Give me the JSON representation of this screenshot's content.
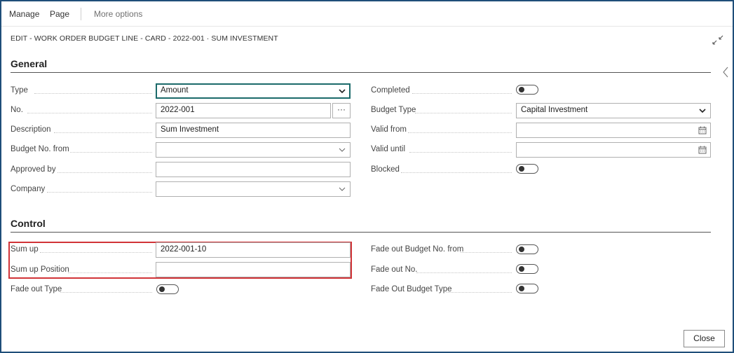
{
  "menu": {
    "manage": "Manage",
    "page": "Page",
    "more_options": "More options"
  },
  "title": "EDIT - WORK ORDER BUDGET LINE - CARD - 2022-001 · SUM INVESTMENT",
  "general": {
    "heading": "General",
    "left": [
      {
        "label": "Type",
        "value": "Amount",
        "control": "select-focused"
      },
      {
        "label": "No.",
        "value": "2022-001",
        "control": "text-with-lookup",
        "lookup_label": "···"
      },
      {
        "label": "Description",
        "value": "Sum Investment",
        "control": "text"
      },
      {
        "label": "Budget No. from",
        "value": "",
        "control": "select"
      },
      {
        "label": "Approved by",
        "value": "",
        "control": "text"
      },
      {
        "label": "Company",
        "value": "",
        "control": "select"
      }
    ],
    "right": [
      {
        "label": "Completed",
        "value": "off",
        "control": "toggle"
      },
      {
        "label": "Budget Type",
        "value": "Capital Investment",
        "control": "select"
      },
      {
        "label": "Valid from",
        "value": "",
        "control": "date"
      },
      {
        "label": "Valid until",
        "value": "",
        "control": "date"
      },
      {
        "label": "Blocked",
        "value": "off",
        "control": "toggle"
      }
    ]
  },
  "control": {
    "heading": "Control",
    "left": [
      {
        "label": "Sum up",
        "value": "2022-001-10",
        "control": "text"
      },
      {
        "label": "Sum up Position",
        "value": "",
        "control": "text"
      },
      {
        "label": "Fade out Type",
        "value": "off",
        "control": "toggle"
      }
    ],
    "right": [
      {
        "label": "Fade out Budget No. from",
        "value": "off",
        "control": "toggle"
      },
      {
        "label": "Fade out No.",
        "value": "off",
        "control": "toggle"
      },
      {
        "label": "Fade Out Budget Type",
        "value": "off",
        "control": "toggle"
      }
    ]
  },
  "footer": {
    "close_label": "Close"
  },
  "colors": {
    "frame": "#1f4e79",
    "focus": "#1b6a6a",
    "highlight": "#d13438"
  },
  "icons": {
    "collapse": "collapse-arrows-icon",
    "side": "chevron-left-icon",
    "dropdown": "chevron-down-icon",
    "date": "calendar-icon"
  }
}
